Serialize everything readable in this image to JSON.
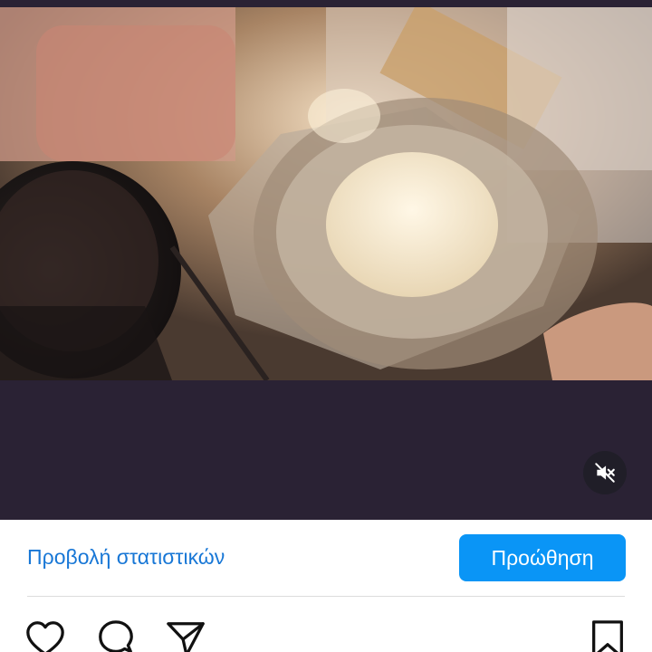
{
  "post": {
    "media": {
      "type": "video",
      "content": "kitchen-cooking-scene",
      "muted": true,
      "mute_icon": "speaker-muted-icon"
    },
    "insights_label": "Προβολή στατιστικών",
    "promote_label": "Προώθηση",
    "colors": {
      "link": "#1877d6",
      "promote_button": "#0a95f6",
      "video_background": "#2a2234"
    },
    "actions": {
      "like_icon": "heart-icon",
      "comment_icon": "comment-bubble-icon",
      "share_icon": "paper-plane-icon",
      "save_icon": "bookmark-icon"
    }
  }
}
